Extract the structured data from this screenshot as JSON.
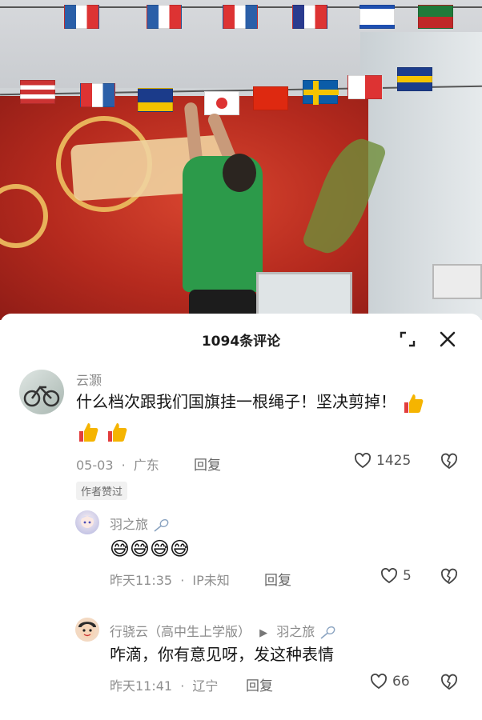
{
  "sheet": {
    "title": "1094条评论"
  },
  "icons": {
    "expand": "expand-icon",
    "close": "close-icon",
    "like": "heart-icon",
    "dislike": "broken-heart-icon",
    "thumbs_up": "thumbs-up-emoji",
    "sweat_smile": "sweat-smile-emoji",
    "badminton": "badminton-racket-icon"
  },
  "comments": [
    {
      "author": "云灏",
      "text": "什么档次跟我们国旗挂一根绳子！坚决剪掉！",
      "date": "05-03",
      "location": "广东",
      "reply_label": "回复",
      "likes": "1425",
      "author_tag": "作者赞过"
    }
  ],
  "replies": [
    {
      "author": "羽之旅",
      "text_emoji": "😅😅😅😅",
      "date": "昨天11:35",
      "location": "IP未知",
      "reply_label": "回复",
      "likes": "5"
    },
    {
      "author": "行骁云（高中生上学版）",
      "reply_to": "羽之旅",
      "text": "咋滴，你有意见呀，发这种表情",
      "date": "昨天11:41",
      "location": "辽宁",
      "reply_label": "回复",
      "likes": "66"
    }
  ],
  "meta_separator": "·",
  "colors": {
    "sheet_bg": "#ffffff",
    "primary_text": "#161616",
    "secondary_text": "#8f8f8f",
    "thumbs_up": "#f5b400",
    "mural_red": "#b52a1e",
    "shirt_green": "#2c9a4a"
  }
}
